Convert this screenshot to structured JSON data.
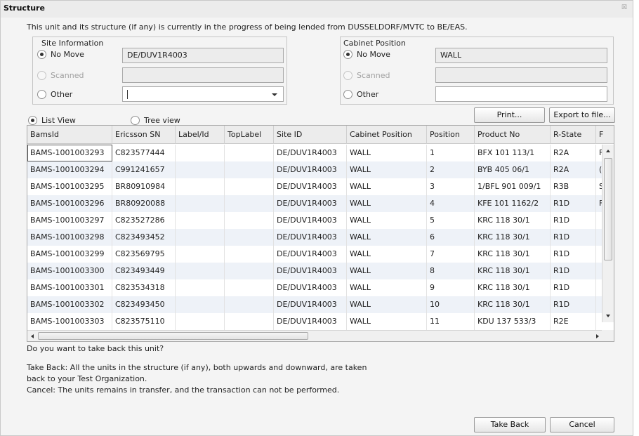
{
  "window": {
    "title": "Structure",
    "close_glyph": "☒"
  },
  "info_text": "This unit and its structure (if any) is currently in the progress of being lended from DUSSELDORF/MVTC to BE/EAS.",
  "site_info": {
    "group_title": "Site Information",
    "no_move_label": "No Move",
    "no_move_value": "DE/DUV1R4003",
    "scanned_label": "Scanned",
    "scanned_value": "",
    "other_label": "Other",
    "selected": "No Move"
  },
  "cabinet_position": {
    "group_title": "Cabinet Position",
    "no_move_label": "No Move",
    "no_move_value": "WALL",
    "scanned_label": "Scanned",
    "scanned_value": "",
    "other_label": "Other",
    "other_value": "",
    "selected": "No Move"
  },
  "view": {
    "list_view_label": "List View",
    "tree_view_label": "Tree view",
    "selected": "List View"
  },
  "toolbar": {
    "print_label": "Print...",
    "export_label": "Export to file..."
  },
  "grid": {
    "columns": [
      "BamsId",
      "Ericsson SN",
      "Label/Id",
      "TopLabel",
      "Site ID",
      "Cabinet Position",
      "Position",
      "Product No",
      "R-State",
      "F"
    ],
    "rows": [
      [
        "BAMS-1001003293",
        "C823577444",
        "",
        "",
        "DE/DUV1R4003",
        "WALL",
        "1",
        "BFX 101 113/1",
        "R2A",
        "F"
      ],
      [
        "BAMS-1001003294",
        "C991241657",
        "",
        "",
        "DE/DUV1R4003",
        "WALL",
        "2",
        "BYB 405 06/1",
        "R2A",
        "("
      ],
      [
        "BAMS-1001003295",
        "BR80910984",
        "",
        "",
        "DE/DUV1R4003",
        "WALL",
        "3",
        "1/BFL 901 009/1",
        "R3B",
        "S"
      ],
      [
        "BAMS-1001003296",
        "BR80920088",
        "",
        "",
        "DE/DUV1R4003",
        "WALL",
        "4",
        "KFE 101 1162/2",
        "R1D",
        "F"
      ],
      [
        "BAMS-1001003297",
        "C823527286",
        "",
        "",
        "DE/DUV1R4003",
        "WALL",
        "5",
        "KRC 118 30/1",
        "R1D",
        ""
      ],
      [
        "BAMS-1001003298",
        "C823493452",
        "",
        "",
        "DE/DUV1R4003",
        "WALL",
        "6",
        "KRC 118 30/1",
        "R1D",
        ""
      ],
      [
        "BAMS-1001003299",
        "C823569795",
        "",
        "",
        "DE/DUV1R4003",
        "WALL",
        "7",
        "KRC 118 30/1",
        "R1D",
        ""
      ],
      [
        "BAMS-1001003300",
        "C823493449",
        "",
        "",
        "DE/DUV1R4003",
        "WALL",
        "8",
        "KRC 118 30/1",
        "R1D",
        ""
      ],
      [
        "BAMS-1001003301",
        "C823534318",
        "",
        "",
        "DE/DUV1R4003",
        "WALL",
        "9",
        "KRC 118 30/1",
        "R1D",
        ""
      ],
      [
        "BAMS-1001003302",
        "C823493450",
        "",
        "",
        "DE/DUV1R4003",
        "WALL",
        "10",
        "KRC 118 30/1",
        "R1D",
        ""
      ],
      [
        "BAMS-1001003303",
        "C823575110",
        "",
        "",
        "DE/DUV1R4003",
        "WALL",
        "11",
        "KDU 137 533/3",
        "R2E",
        ""
      ]
    ],
    "selected_row": 0
  },
  "message": {
    "question": "Do you want to take back this unit?",
    "take_back_line1": "Take Back: All the units in the structure (if any), both upwards and downward, are taken",
    "take_back_line2": "back to your Test Organization.",
    "cancel_line": "Cancel: The units remains in transfer, and the transaction can not be performed."
  },
  "buttons": {
    "take_back_label": "Take Back",
    "cancel_label": "Cancel"
  }
}
